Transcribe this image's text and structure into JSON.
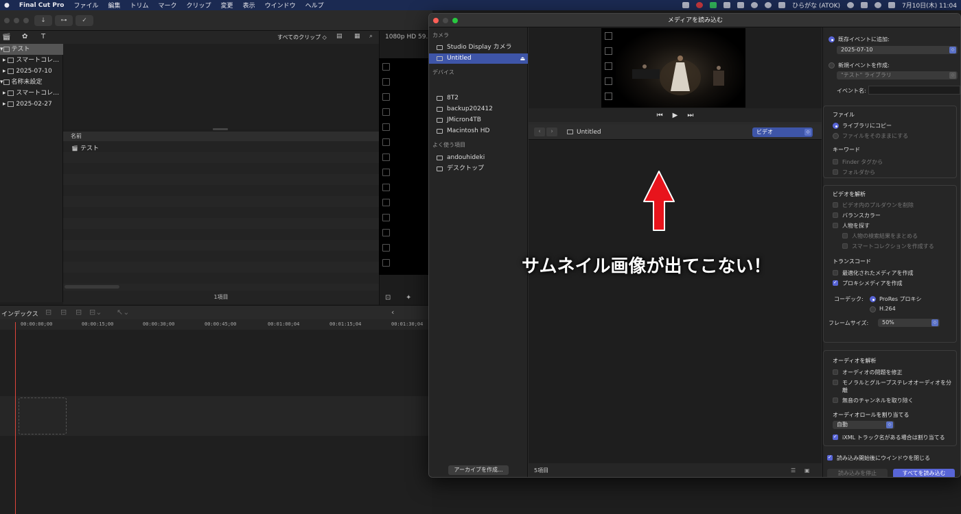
{
  "menubar": {
    "app": "Final Cut Pro",
    "items": [
      "ファイル",
      "編集",
      "トリム",
      "マーク",
      "クリップ",
      "変更",
      "表示",
      "ウインドウ",
      "ヘルプ"
    ],
    "input_method": "ひらがな (ATOK)",
    "datetime": "7月10日(木) 11:04"
  },
  "library": {
    "rows": [
      {
        "label": "テスト"
      },
      {
        "label": "スマートコレ…"
      },
      {
        "label": "2025-07-10"
      },
      {
        "label": "名称未設定"
      },
      {
        "label": "スマートコレ…"
      },
      {
        "label": "2025-02-27"
      }
    ]
  },
  "browser": {
    "filter": "すべてのクリップ ◇",
    "column_name": "名前",
    "items": [
      {
        "name": "テスト"
      }
    ],
    "count": "1項目"
  },
  "viewer": {
    "format": "1080p HD 59.94"
  },
  "timeline": {
    "index_label": "インデックス",
    "timecodes": [
      "00:00:00;00",
      "00:00:15;00",
      "00:00:30;00",
      "00:00:45;00",
      "00:01:00;04",
      "00:01:15;04",
      "00:01:30;04"
    ]
  },
  "import_window": {
    "title": "メディアを読み込む",
    "sidebar": {
      "camera_header": "カメラ",
      "cameras": [
        "Studio Display カメラ",
        "Untitled"
      ],
      "devices_header": "デバイス",
      "devices": [
        "8T2",
        "backup202412",
        "JMicron4TB",
        "Macintosh HD"
      ],
      "favorites_header": "よく使う項目",
      "favorites": [
        "andouhideki",
        "デスクトップ"
      ],
      "archive_button": "アーカイブを作成..."
    },
    "path": {
      "current": "Untitled",
      "filter": "ビデオ"
    },
    "footer_count": "5項目",
    "annotation": "サムネイル画像が出てこない！",
    "options": {
      "add_existing": "既存イベントに追加:",
      "existing_event": "2025-07-10",
      "new_event": "新規イベントを作成:",
      "new_event_library": "\"テスト\" ライブラリ",
      "event_name_label": "イベント名:",
      "file_header": "ファイル",
      "copy_to_library": "ライブラリにコピー",
      "leave_in_place": "ファイルをそのままにする",
      "keywords_header": "キーワード",
      "from_finder_tags": "Finder タグから",
      "from_folders": "フォルダから",
      "analyze_video_header": "ビデオを解析",
      "remove_pulldown": "ビデオ内のプルダウンを削除",
      "balance_color": "バランスカラー",
      "find_people": "人物を探す",
      "consolidate_people": "人物の検索結果をまとめる",
      "create_smart_collections": "スマートコレクションを作成する",
      "transcode_header": "トランスコード",
      "create_optimized": "最適化されたメディアを作成",
      "create_proxy": "プロキシメディアを作成",
      "codec_label": "コーデック:",
      "codec_prores": "ProRes プロキシ",
      "codec_h264": "H.264",
      "frame_size_label": "フレームサイズ:",
      "frame_size": "50%",
      "analyze_audio_header": "オーディオを解析",
      "fix_audio": "オーディオの問題を修正",
      "separate_mono": "モノラルとグループステレオオーディオを分離",
      "remove_silent": "無音のチャンネルを取り除く",
      "assign_roles_header": "オーディオロールを割り当てる",
      "role_value": "自動",
      "ixml": "iXML トラック名がある場合は割り当てる",
      "close_after_import": "読み込み開始後にウインドウを閉じる",
      "stop_import": "読み込みを停止",
      "import_all": "すべてを読み込む"
    }
  },
  "colors": {
    "accent": "#5865d6",
    "selection": "#3e55a8",
    "menubar": "#1b2a52",
    "annotation_arrow": "#e8141c",
    "playhead": "#e2463b"
  }
}
